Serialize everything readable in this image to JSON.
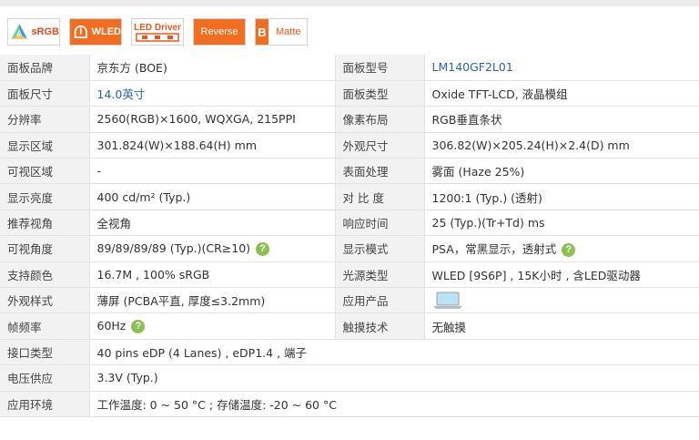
{
  "badges": {
    "srgb": "sRGB",
    "wled": "WLED",
    "driver": "LED Driver",
    "reverse": "Reverse",
    "matte_letter": "B",
    "matte": "Matte"
  },
  "colors": {
    "accent": "#f36d21",
    "link": "#2b66ab",
    "help": "#8cc152",
    "label_bg": "#f2f2f2"
  },
  "rows": [
    {
      "k1": "面板品牌",
      "v1": "京东方 (BOE)",
      "k2": "面板型号",
      "v2": "LM140GF2L01"
    },
    {
      "k1": "面板尺寸",
      "v1": "14.0英寸",
      "k2": "面板类型",
      "v2": "Oxide TFT-LCD, 液晶模组"
    },
    {
      "k1": "分辨率",
      "v1": "2560(RGB)×1600, WQXGA, 215PPI",
      "k2": "像素布局",
      "v2": "RGB垂直条状"
    },
    {
      "k1": "显示区域",
      "v1": "301.824(W)×188.64(H) mm",
      "k2": "外观尺寸",
      "v2": "306.82(W)×205.24(H)×2.4(D) mm"
    },
    {
      "k1": "可视区域",
      "v1": "-",
      "k2": "表面处理",
      "v2": "雾面 (Haze 25%)"
    },
    {
      "k1": "显示亮度",
      "v1": "400 cd/m² (Typ.)",
      "k2": "对 比 度",
      "v2": "1200:1 (Typ.) (透射)"
    },
    {
      "k1": "推荐视角",
      "v1": "全视角",
      "k2": "响应时间",
      "v2": "25 (Typ.)(Tr+Td) ms"
    },
    {
      "k1": "可视角度",
      "v1": "89/89/89/89 (Typ.)(CR≥10)",
      "k2": "显示模式",
      "v2": "PSA，常黑显示，透射式"
    },
    {
      "k1": "支持颜色",
      "v1": "16.7M , 100% sRGB",
      "k2": "光源类型",
      "v2": "WLED  [9S6P] , 15K小时 , 含LED驱动器"
    },
    {
      "k1": "外观样式",
      "v1": "薄屏 (PCBA平直, 厚度≤3.2mm)",
      "k2": "应用产品",
      "v2": ""
    },
    {
      "k1": "帧频率",
      "v1": "60Hz",
      "k2": "触摸技术",
      "v2": "无触摸"
    },
    {
      "k1": "接口类型",
      "v1": "40 pins   eDP (4 Lanes) , eDP1.4 , 端子"
    },
    {
      "k1": "电压供应",
      "v1": "3.3V (Typ.)"
    },
    {
      "k1": "应用环境",
      "v1": "工作温度: 0 ~ 50 °C ; 存储温度: -20 ~ 60 °C"
    }
  ],
  "help_mark": "?",
  "icons": {
    "laptop": "laptop-icon",
    "help": "help-icon",
    "srgb": "color-gamut-icon",
    "wled": "led-icon"
  }
}
